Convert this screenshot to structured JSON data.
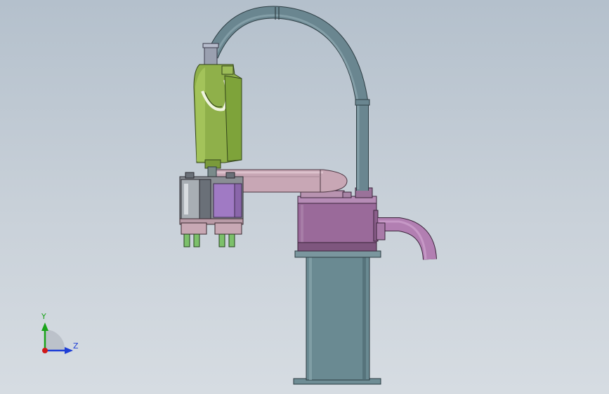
{
  "triad": {
    "y_label": "Y",
    "z_label": "Z",
    "colors": {
      "y": "#1aa31a",
      "z": "#1f3fd6",
      "x": "#d01818"
    }
  },
  "colors": {
    "cable": "#6a8690",
    "elbow_link": "#7ea33a",
    "arm": "#c8a7b5",
    "base_box": "#9a6a9a",
    "pedestal": "#6a8a92",
    "gripper_purple": "#a07ac4",
    "gripper_green": "#7cc06a"
  }
}
